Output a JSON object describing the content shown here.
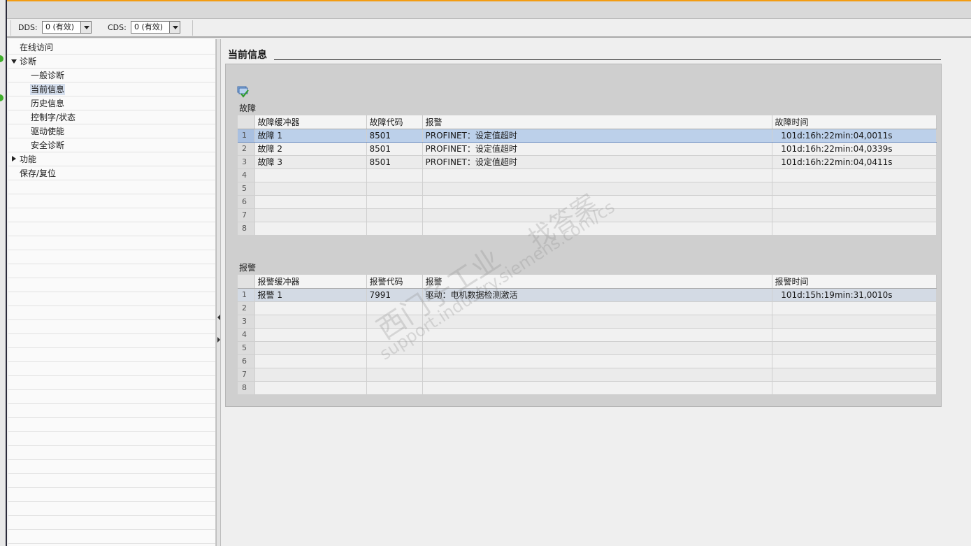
{
  "toolbar": {
    "dds_label": "DDS:",
    "dds_value": "0 (有效)",
    "cds_label": "CDS:",
    "cds_value": "0 (有效)"
  },
  "nav": {
    "items": [
      {
        "label": "在线访问"
      },
      {
        "label": "诊断"
      },
      {
        "label": "一般诊断"
      },
      {
        "label": "当前信息"
      },
      {
        "label": "历史信息"
      },
      {
        "label": "控制字/状态"
      },
      {
        "label": "驱动使能"
      },
      {
        "label": "安全诊断"
      },
      {
        "label": "功能"
      },
      {
        "label": "保存/复位"
      }
    ]
  },
  "content": {
    "title": "当前信息",
    "faults": {
      "section_title": "故障",
      "columns": [
        "故障缓冲器",
        "故障代码",
        "报警",
        "故障时间"
      ],
      "rows": [
        {
          "num": "1",
          "buffer": "故障 1",
          "code": "8501",
          "message": "PROFINET：设定值超时",
          "time": "101d:16h:22min:04,0011s"
        },
        {
          "num": "2",
          "buffer": "故障 2",
          "code": "8501",
          "message": "PROFINET：设定值超时",
          "time": "101d:16h:22min:04,0339s"
        },
        {
          "num": "3",
          "buffer": "故障 3",
          "code": "8501",
          "message": "PROFINET：设定值超时",
          "time": "101d:16h:22min:04,0411s"
        },
        {
          "num": "4",
          "buffer": "",
          "code": "",
          "message": "",
          "time": ""
        },
        {
          "num": "5",
          "buffer": "",
          "code": "",
          "message": "",
          "time": ""
        },
        {
          "num": "6",
          "buffer": "",
          "code": "",
          "message": "",
          "time": ""
        },
        {
          "num": "7",
          "buffer": "",
          "code": "",
          "message": "",
          "time": ""
        },
        {
          "num": "8",
          "buffer": "",
          "code": "",
          "message": "",
          "time": ""
        }
      ]
    },
    "alarms": {
      "section_title": "报警",
      "columns": [
        "报警缓冲器",
        "报警代码",
        "报警",
        "报警时间"
      ],
      "rows": [
        {
          "num": "1",
          "buffer": "报警 1",
          "code": "7991",
          "message": "驱动：电机数据检测激活",
          "time": "101d:15h:19min:31,0010s"
        },
        {
          "num": "2",
          "buffer": "",
          "code": "",
          "message": "",
          "time": ""
        },
        {
          "num": "3",
          "buffer": "",
          "code": "",
          "message": "",
          "time": ""
        },
        {
          "num": "4",
          "buffer": "",
          "code": "",
          "message": "",
          "time": ""
        },
        {
          "num": "5",
          "buffer": "",
          "code": "",
          "message": "",
          "time": ""
        },
        {
          "num": "6",
          "buffer": "",
          "code": "",
          "message": "",
          "time": ""
        },
        {
          "num": "7",
          "buffer": "",
          "code": "",
          "message": "",
          "time": ""
        },
        {
          "num": "8",
          "buffer": "",
          "code": "",
          "message": "",
          "time": ""
        }
      ]
    },
    "watermark": {
      "line1": "西门子工业",
      "line2": "找答案",
      "line3": "support.industry.siemens.com/cs"
    }
  },
  "icons": {
    "refresh": "refresh-buffer-icon",
    "status_ok": "status-ok-icon"
  },
  "colors": {
    "accent": "#f39c12",
    "selection": "#bcd0ea",
    "status_ok": "#3fae2a"
  }
}
